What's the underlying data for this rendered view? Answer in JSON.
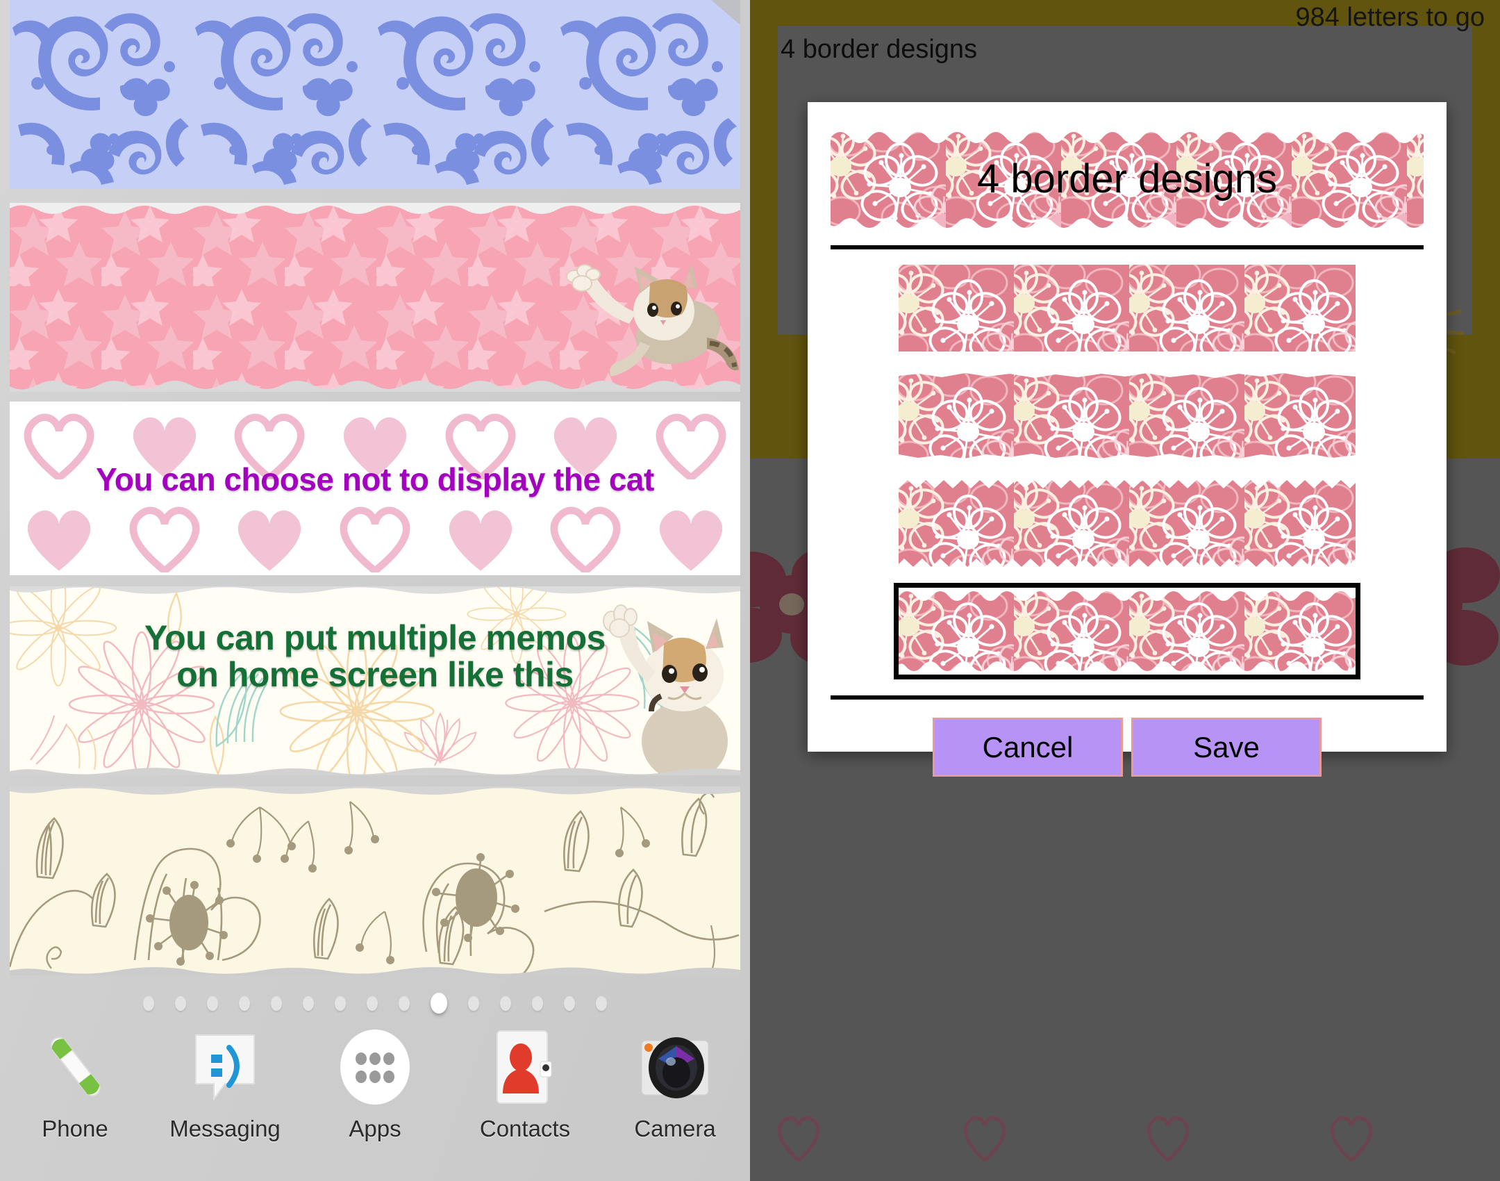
{
  "home": {
    "widgets": [
      {
        "name": "blue-damask-border",
        "text": "",
        "style": "blue-floral"
      },
      {
        "name": "sakura-cat-border",
        "text": "",
        "style": "pink-sakura",
        "has_cat": true
      },
      {
        "name": "hearts-memo",
        "text": "You can choose not to display the cat",
        "text_color": "#a300c0",
        "style": "hearts"
      },
      {
        "name": "flower-memo",
        "text": "You can put multiple memos\non home screen like this",
        "text_color": "#157038",
        "style": "pastel-flowers",
        "has_cat": true
      },
      {
        "name": "cream-botanical-border",
        "text": "",
        "style": "cream-botanical"
      }
    ],
    "page_indicator": {
      "total": 15,
      "active_index": 9
    },
    "dock": [
      {
        "label": "Phone",
        "icon": "phone-handset-icon"
      },
      {
        "label": "Messaging",
        "icon": "speech-bubble-icon"
      },
      {
        "label": "Apps",
        "icon": "app-grid-icon"
      },
      {
        "label": "Contacts",
        "icon": "contact-person-icon"
      },
      {
        "label": "Camera",
        "icon": "camera-lens-icon"
      }
    ]
  },
  "app": {
    "letters_remaining": "984 letters to go",
    "panel_title": "4 border designs"
  },
  "dialog": {
    "title": "4 border designs",
    "options": [
      {
        "id": "border-1",
        "edge": "straight",
        "selected": false
      },
      {
        "id": "border-2",
        "edge": "torn",
        "selected": false
      },
      {
        "id": "border-3",
        "edge": "zigzag",
        "selected": false
      },
      {
        "id": "border-4",
        "edge": "scallop",
        "selected": true
      }
    ],
    "cancel_label": "Cancel",
    "save_label": "Save"
  },
  "colors": {
    "olive": "#7d6c12",
    "grey": "#6e6e6e",
    "pink_border": "#e0808f",
    "button_fill": "#b793f5",
    "button_border": "#e89a94",
    "purple_text": "#a300c0",
    "green_text": "#157038"
  }
}
